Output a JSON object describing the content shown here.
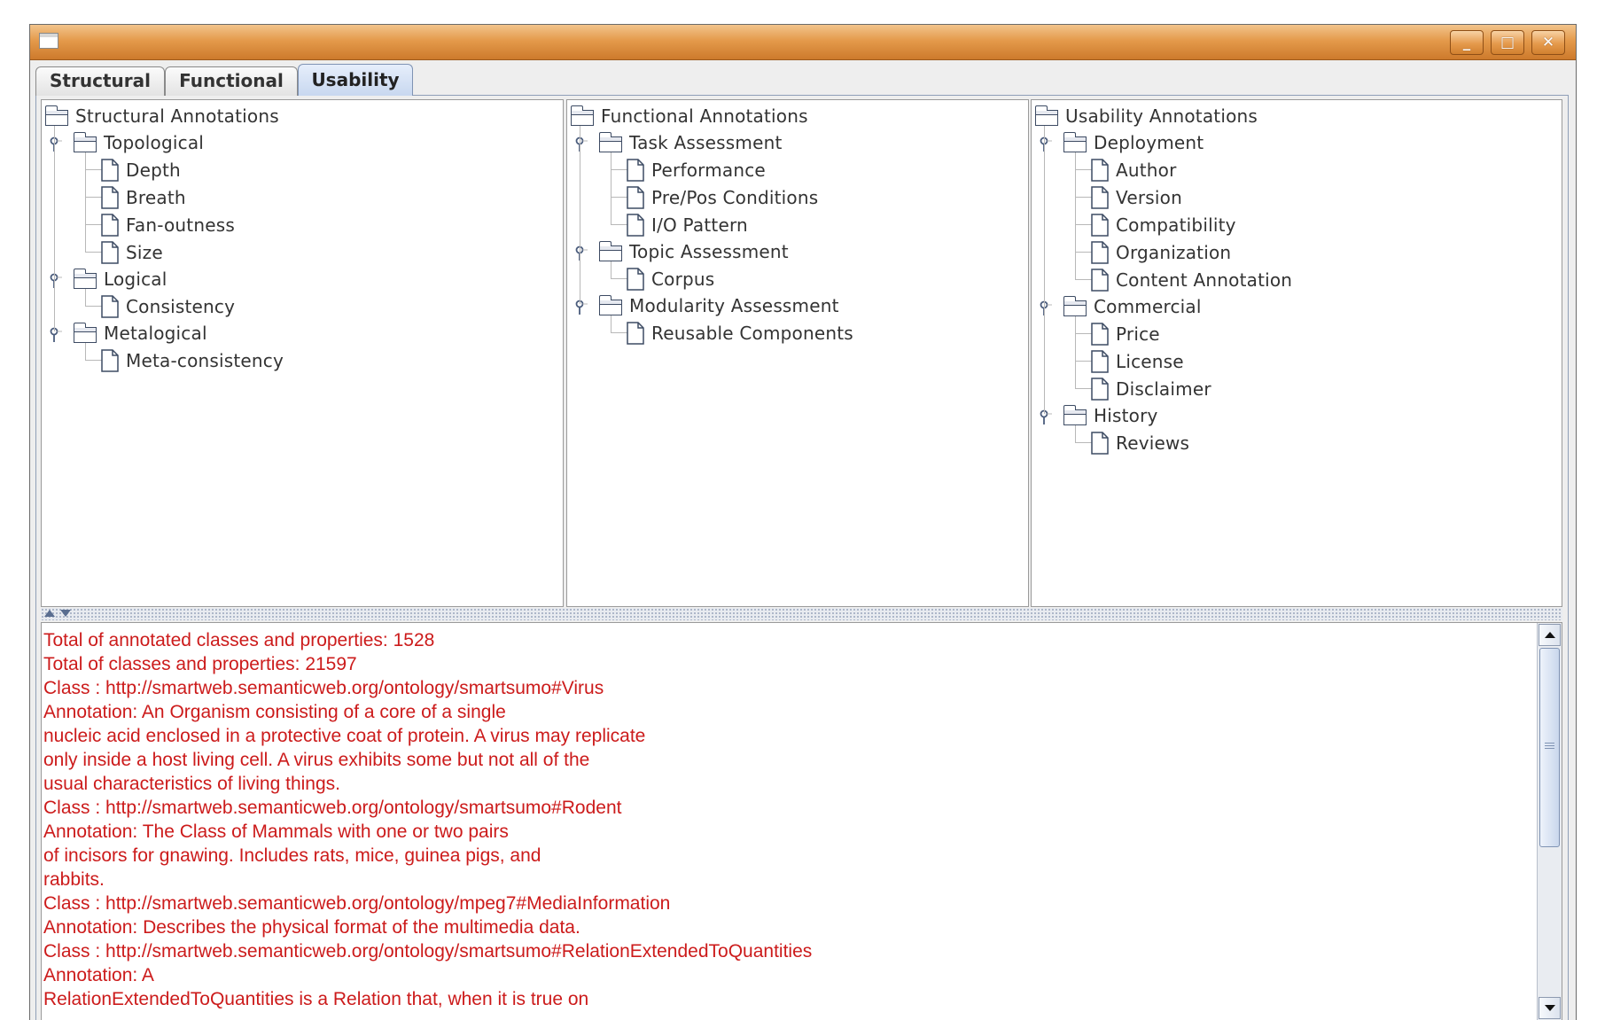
{
  "window": {
    "title": "",
    "controls": {
      "minimize": "_",
      "maximize": "□",
      "close": "✕"
    }
  },
  "tabs": [
    {
      "label": "Structural",
      "selected": false
    },
    {
      "label": "Functional",
      "selected": false
    },
    {
      "label": "Usability",
      "selected": true
    }
  ],
  "trees": {
    "structural": {
      "root": "Structural Annotations",
      "groups": [
        {
          "label": "Topological",
          "children": [
            "Depth",
            "Breath",
            "Fan-outness",
            "Size"
          ]
        },
        {
          "label": "Logical",
          "children": [
            "Consistency"
          ]
        },
        {
          "label": "Metalogical",
          "children": [
            "Meta-consistency"
          ]
        }
      ]
    },
    "functional": {
      "root": "Functional Annotations",
      "groups": [
        {
          "label": "Task Assessment",
          "children": [
            "Performance",
            "Pre/Pos Conditions",
            "I/O Pattern"
          ]
        },
        {
          "label": "Topic Assessment",
          "children": [
            "Corpus"
          ]
        },
        {
          "label": "Modularity Assessment",
          "children": [
            "Reusable Components"
          ]
        }
      ]
    },
    "usability": {
      "root": "Usability Annotations",
      "groups": [
        {
          "label": "Deployment",
          "children": [
            "Author",
            "Version",
            "Compatibility",
            "Organization",
            "Content Annotation"
          ]
        },
        {
          "label": "Commercial",
          "children": [
            "Price",
            "License",
            "Disclaimer"
          ]
        },
        {
          "label": "History",
          "children": [
            "Reviews"
          ]
        }
      ]
    }
  },
  "log": {
    "lines": [
      "Total of annotated classes and properties: 1528",
      "Total of classes and properties: 21597",
      "Class : http://smartweb.semanticweb.org/ontology/smartsumo#Virus",
      "Annotation: An Organism consisting of a core of a single",
      "nucleic acid enclosed in a protective coat of protein. A virus may replicate",
      "only inside a host living cell. A virus exhibits some but not all of the",
      "usual characteristics of living things.",
      "Class : http://smartweb.semanticweb.org/ontology/smartsumo#Rodent",
      "Annotation: The Class of Mammals with one or two pairs",
      "of incisors for gnawing.  Includes rats, mice, guinea pigs, and",
      "rabbits.",
      "Class : http://smartweb.semanticweb.org/ontology/mpeg7#MediaInformation",
      "Annotation: Describes the physical format of the multimedia data.",
      "Class : http://smartweb.semanticweb.org/ontology/smartsumo#RelationExtendedToQuantities",
      "Annotation: A",
      "RelationExtendedToQuantities is a Relation that, when it is true on"
    ],
    "text_color": "#cc1b1b"
  },
  "colors": {
    "titlebar_accent": "#e49a4b",
    "selected_tab": "#c7d7ef"
  },
  "icons": {
    "group": "folder-icon",
    "leaf": "document-icon",
    "expander": "expander-handle-icon"
  }
}
